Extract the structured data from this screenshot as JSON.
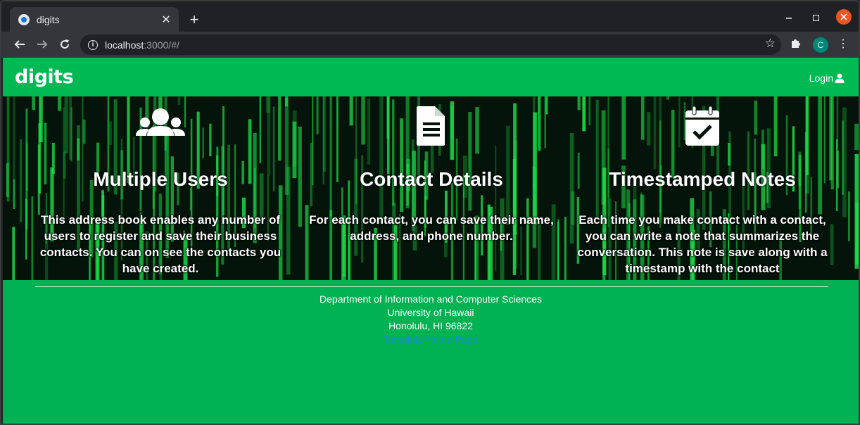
{
  "browser": {
    "tab_title": "digits",
    "tab_close": "✕",
    "new_tab": "+",
    "url_host": "localhost",
    "url_path": ":3000/#/",
    "profile_initial": "C"
  },
  "navbar": {
    "brand": "digits",
    "login_label": "Login"
  },
  "features": [
    {
      "icon": "users-icon",
      "title": "Multiple Users",
      "text": "This address book enables any number of users to register and save their business contacts. You can on see the contacts you have created."
    },
    {
      "icon": "file-text-icon",
      "title": "Contact Details",
      "text": "For each contact, you can save their name, address, and phone number."
    },
    {
      "icon": "calendar-check-icon",
      "title": "Timestamped Notes",
      "text": "Each time you make contact with a contact, you can write a note that summarizes the conversation. This note is save along with a timestamp with the contact"
    }
  ],
  "footer": {
    "line1": "Department of Information and Computer Sciences",
    "line2": "University of Hawaii",
    "line3": "Honolulu, HI 96822",
    "link": "Template Home Page"
  },
  "colors": {
    "page_green": "#00b251",
    "hero_bg": "#04140a",
    "matrix_green": "#1ee04a",
    "link_blue": "#1a8fd0"
  }
}
